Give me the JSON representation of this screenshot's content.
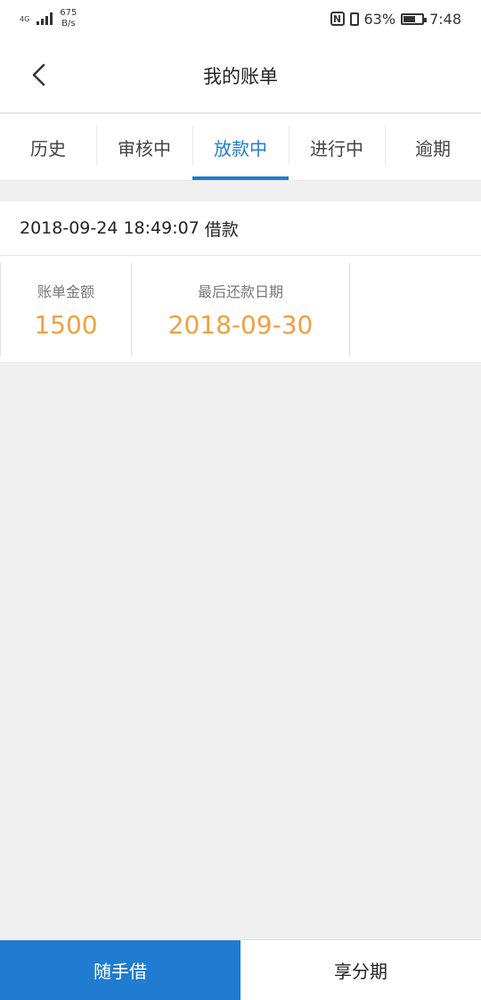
{
  "status_bar": {
    "network": "4G",
    "speed_value": "675",
    "speed_unit": "B/s",
    "nfc_label": "N",
    "battery_percent": "63%",
    "battery_level": 0.63,
    "time": "7:48"
  },
  "header": {
    "title": "我的账单"
  },
  "tabs": [
    {
      "label": "历史",
      "active": false
    },
    {
      "label": "审核中",
      "active": false
    },
    {
      "label": "放款中",
      "active": true
    },
    {
      "label": "进行中",
      "active": false
    },
    {
      "label": "逾期",
      "active": false
    }
  ],
  "bill": {
    "datetime": "2018-09-24 18:49:07",
    "type": "借款",
    "amount_label": "账单金额",
    "amount": "1500",
    "due_label": "最后还款日期",
    "due_date": "2018-09-30"
  },
  "bottom_bar": {
    "primary_label": "随手借",
    "secondary_label": "享分期"
  },
  "colors": {
    "accent": "#1f7cd0",
    "value_orange": "#f0a041",
    "background": "#f0f0f0"
  }
}
